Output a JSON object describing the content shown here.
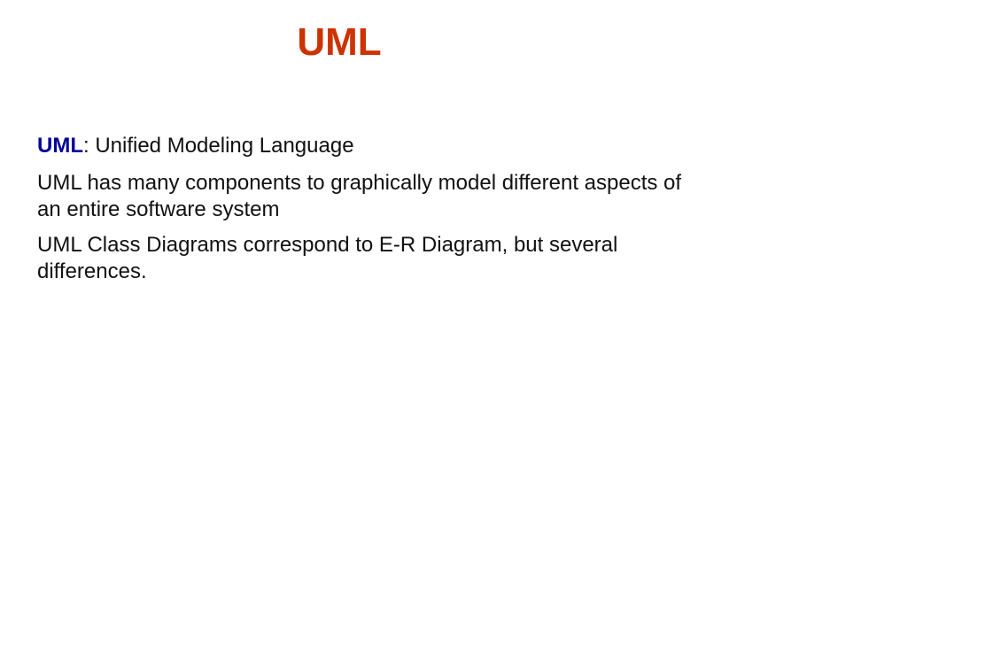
{
  "slide": {
    "title": "UML",
    "title_color": "#CC3300",
    "term_color": "#000099",
    "paragraphs": [
      {
        "term": "UML",
        "text": ": Unified Modeling Language"
      },
      {
        "text": "UML has many components to graphically model different aspects of an entire software system"
      },
      {
        "text": "UML Class Diagrams correspond to E-R Diagram, but several differences."
      }
    ]
  }
}
